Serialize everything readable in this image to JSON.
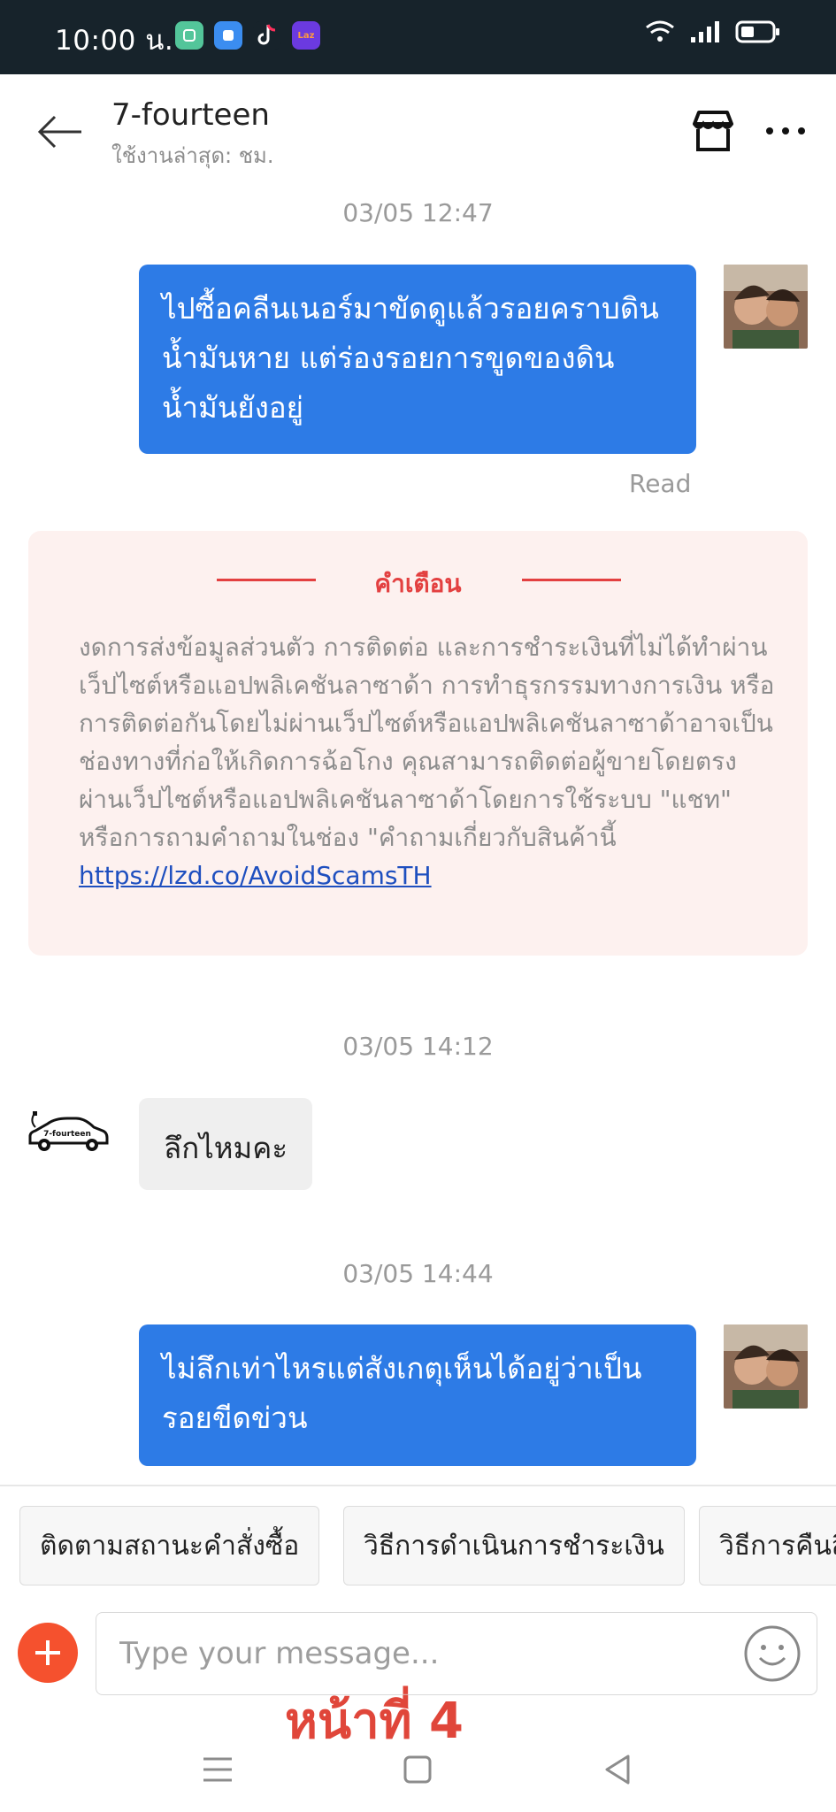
{
  "status_bar": {
    "time": "10:00 น.",
    "apps": [
      {
        "icon": "app-green-icon",
        "color": "#53c59a"
      },
      {
        "icon": "app-blue-icon",
        "color": "#3b8df0"
      },
      {
        "icon": "tiktok-icon",
        "color": "#17232b"
      },
      {
        "icon": "lazada-icon",
        "color": "#6b3ae0",
        "label": "Laz"
      }
    ]
  },
  "header": {
    "title": "7-fourteen",
    "subtitle": "ใช้งานล่าสุด: ชม."
  },
  "messages": {
    "ts1": "03/05 12:47",
    "msg1": "ไปซื้อคลีนเนอร์มาขัดดูแล้วรอยคราบดินน้ำมันหาย แต่ร่องรอยการขูดของดินน้ำมันยังอยู่",
    "read": "Read",
    "ts2": "03/05 14:12",
    "msg2": "ลึกไหมคะ",
    "ts3": "03/05 14:44",
    "msg3": "ไม่ลึกเท่าไหรแต่สังเกตุเห็นได้อยู่ว่าเป็นรอยขีดข่วน"
  },
  "warning": {
    "title": "คำเตือน",
    "body": "งดการส่งข้อมูลส่วนตัว การติดต่อ และการชำระเงินที่ไม่ได้ทำผ่านเว็ปไซต์หรือแอปพลิเคชันลาซาด้า การทำธุรกรรมทางการเงิน หรือการติดต่อกันโดยไม่ผ่านเว็ปไซต์หรือแอปพลิเคชันลาซาด้าอาจเป็นช่องทางที่ก่อให้เกิดการฉ้อโกง คุณสามารถติดต่อผู้ขายโดยตรงผ่านเว็ปไซต์หรือแอปพลิเคชันลาซาด้าโดยการใช้ระบบ \"แชท\" หรือการถามคำถามในช่อง \"คำถามเกี่ยวกับสินค้านี้",
    "link": "https://lzd.co/AvoidScamsTH"
  },
  "seller_logo_text": "7-fourteen",
  "quick_replies": [
    "ติดตามสถานะคำสั่งซื้อ",
    "วิธีการดำเนินการชำระเงิน",
    "วิธีการคืนสินค้า"
  ],
  "input": {
    "placeholder": "Type your message..."
  },
  "overlay_note": "หน้าที่ 4",
  "colors": {
    "status_bar": "#17232b",
    "bubble_out": "#2d7be6",
    "warning_bg": "#fdf1ef",
    "warning_accent": "#e34040",
    "add_button": "#f5512e"
  }
}
